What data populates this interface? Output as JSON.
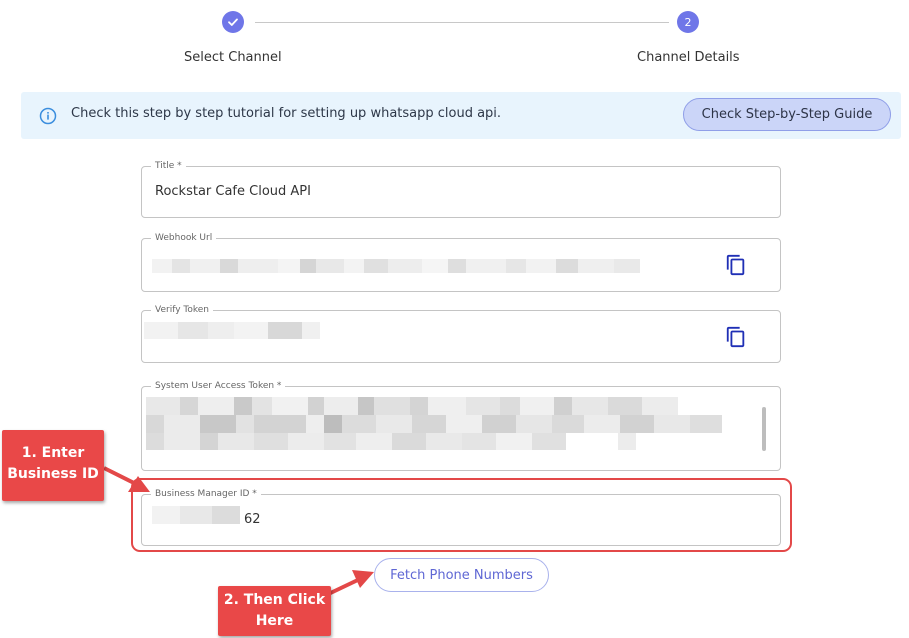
{
  "stepper": {
    "step1": {
      "label": "Select Channel",
      "state": "completed"
    },
    "step2": {
      "label": "Channel Details",
      "number": "2",
      "state": "active"
    }
  },
  "banner": {
    "text": "Check this step by step tutorial for setting up whatsapp cloud api.",
    "button_label": "Check Step-by-Step Guide"
  },
  "form": {
    "title": {
      "label": "Title *",
      "value": "Rockstar Cafe Cloud API"
    },
    "webhook_url": {
      "label": "Webhook Url"
    },
    "verify_token": {
      "label": "Verify Token"
    },
    "access_token": {
      "label": "System User Access Token *"
    },
    "business_manager_id": {
      "label": "Business Manager ID *",
      "value_suffix": "62"
    }
  },
  "fetch_button_label": "Fetch Phone Numbers",
  "annotations": {
    "callout1": {
      "line1": "1. Enter",
      "line2": "Business ID"
    },
    "callout2": {
      "line1": "2. Then Click",
      "line2": "Here"
    }
  },
  "colors": {
    "accent": "#6F76E8",
    "banner_bg": "#E8F4FD",
    "copy_icon": "#1F2FB5",
    "annotation_red": "#E94848"
  }
}
